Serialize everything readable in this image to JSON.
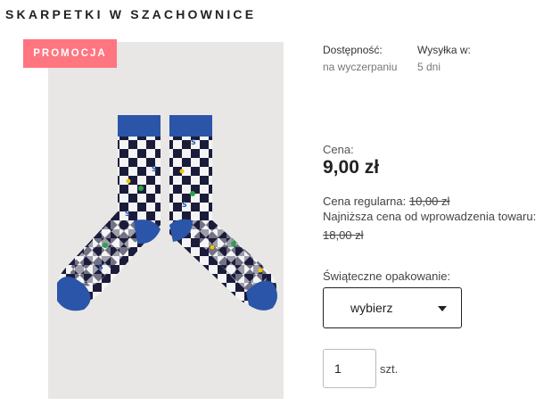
{
  "product": {
    "title": "SKARPETKI W SZACHOWNICE"
  },
  "badge": {
    "label": "PROMOCJA",
    "color": "#ff7580"
  },
  "availability": {
    "label": "Dostępność:",
    "value": "na wyczerpaniu"
  },
  "shipping": {
    "label": "Wysyłka w:",
    "value": "5 dni"
  },
  "price": {
    "label": "Cena:",
    "current": "9,00 zł",
    "regular_label": "Cena regularna:",
    "regular_value": "10,00 zł",
    "lowest_label": "Najniższa cena od wprowadzenia towaru:",
    "lowest_value": "18,00 zł"
  },
  "gift_wrap": {
    "label": "Świąteczne opakowanie:",
    "selected": "wybierz"
  },
  "quantity": {
    "value": "1",
    "unit": "szt."
  },
  "colors": {
    "sock_navy": "#1b1c3a",
    "sock_blue": "#2b55a8",
    "sock_white": "#f4f4f4"
  }
}
